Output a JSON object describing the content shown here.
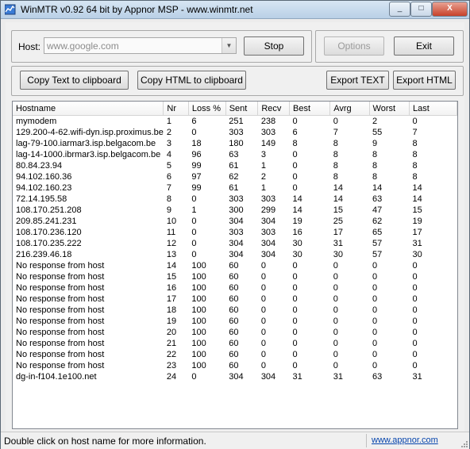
{
  "window": {
    "title": "WinMTR v0.92 64 bit by Appnor MSP - www.winmtr.net"
  },
  "titlebar_buttons": {
    "minimize": "_",
    "restore": "□",
    "close": "X"
  },
  "host_group": {
    "label": "Host:",
    "value": "www.google.com",
    "placeholder": "www.google.com",
    "stop_label": "Stop"
  },
  "top_right": {
    "options_label": "Options",
    "exit_label": "Exit"
  },
  "actions": {
    "copy_text": "Copy Text to clipboard",
    "copy_html": "Copy HTML to clipboard",
    "export_text": "Export TEXT",
    "export_html": "Export HTML"
  },
  "table": {
    "columns": [
      "Hostname",
      "Nr",
      "Loss %",
      "Sent",
      "Recv",
      "Best",
      "Avrg",
      "Worst",
      "Last"
    ],
    "rows": [
      [
        "mymodem",
        "1",
        "6",
        "251",
        "238",
        "0",
        "0",
        "2",
        "0"
      ],
      [
        "129.200-4-62.wifi-dyn.isp.proximus.be",
        "2",
        "0",
        "303",
        "303",
        "6",
        "7",
        "55",
        "7"
      ],
      [
        "lag-79-100.iarmar3.isp.belgacom.be",
        "3",
        "18",
        "180",
        "149",
        "8",
        "8",
        "9",
        "8"
      ],
      [
        "lag-14-1000.ibrmar3.isp.belgacom.be",
        "4",
        "96",
        "63",
        "3",
        "0",
        "8",
        "8",
        "8"
      ],
      [
        "80.84.23.94",
        "5",
        "99",
        "61",
        "1",
        "0",
        "8",
        "8",
        "8"
      ],
      [
        "94.102.160.36",
        "6",
        "97",
        "62",
        "2",
        "0",
        "8",
        "8",
        "8"
      ],
      [
        "94.102.160.23",
        "7",
        "99",
        "61",
        "1",
        "0",
        "14",
        "14",
        "14"
      ],
      [
        "72.14.195.58",
        "8",
        "0",
        "303",
        "303",
        "14",
        "14",
        "63",
        "14"
      ],
      [
        "108.170.251.208",
        "9",
        "1",
        "300",
        "299",
        "14",
        "15",
        "47",
        "15"
      ],
      [
        "209.85.241.231",
        "10",
        "0",
        "304",
        "304",
        "19",
        "25",
        "62",
        "19"
      ],
      [
        "108.170.236.120",
        "11",
        "0",
        "303",
        "303",
        "16",
        "17",
        "65",
        "17"
      ],
      [
        "108.170.235.222",
        "12",
        "0",
        "304",
        "304",
        "30",
        "31",
        "57",
        "31"
      ],
      [
        "216.239.46.18",
        "13",
        "0",
        "304",
        "304",
        "30",
        "30",
        "57",
        "30"
      ],
      [
        "No response from host",
        "14",
        "100",
        "60",
        "0",
        "0",
        "0",
        "0",
        "0"
      ],
      [
        "No response from host",
        "15",
        "100",
        "60",
        "0",
        "0",
        "0",
        "0",
        "0"
      ],
      [
        "No response from host",
        "16",
        "100",
        "60",
        "0",
        "0",
        "0",
        "0",
        "0"
      ],
      [
        "No response from host",
        "17",
        "100",
        "60",
        "0",
        "0",
        "0",
        "0",
        "0"
      ],
      [
        "No response from host",
        "18",
        "100",
        "60",
        "0",
        "0",
        "0",
        "0",
        "0"
      ],
      [
        "No response from host",
        "19",
        "100",
        "60",
        "0",
        "0",
        "0",
        "0",
        "0"
      ],
      [
        "No response from host",
        "20",
        "100",
        "60",
        "0",
        "0",
        "0",
        "0",
        "0"
      ],
      [
        "No response from host",
        "21",
        "100",
        "60",
        "0",
        "0",
        "0",
        "0",
        "0"
      ],
      [
        "No response from host",
        "22",
        "100",
        "60",
        "0",
        "0",
        "0",
        "0",
        "0"
      ],
      [
        "No response from host",
        "23",
        "100",
        "60",
        "0",
        "0",
        "0",
        "0",
        "0"
      ],
      [
        "dg-in-f104.1e100.net",
        "24",
        "0",
        "304",
        "304",
        "31",
        "31",
        "63",
        "31"
      ]
    ]
  },
  "statusbar": {
    "text": "Double click on host name for more information.",
    "link": "www.appnor.com"
  },
  "colors": {
    "link": "#0645ad",
    "close_button": "#c7412a",
    "titlebar": "#c9dcef"
  }
}
